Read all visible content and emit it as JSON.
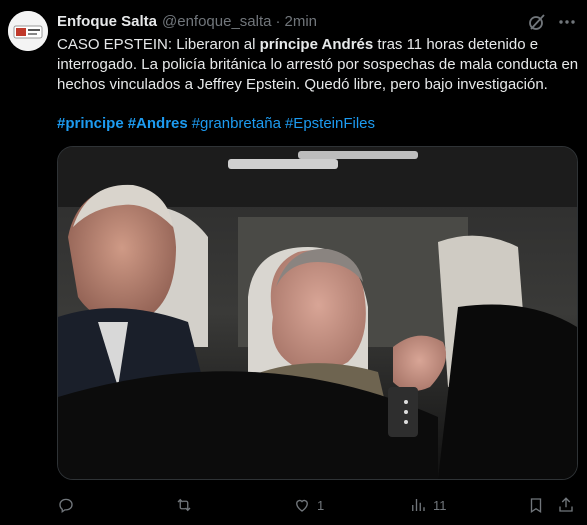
{
  "tweet": {
    "author_name": "Enfoque Salta",
    "handle": "@enfoque_salta",
    "separator": "·",
    "time": "2min",
    "text_1": "CASO EPSTEIN: Liberaron al ",
    "text_bold": "príncipe Andrés",
    "text_2": " tras 11 horas detenido e interrogado. La policía británica lo arrestó por sospechas de mala conducta en hechos vinculados a Jeffrey Epstein. Quedó libre, pero bajo investigación.",
    "hashtags": [
      {
        "text": "#principe",
        "bold": true
      },
      {
        "text": "#Andres",
        "bold": true
      },
      {
        "text": "#granbretaña",
        "bold": false
      },
      {
        "text": "#EpsteinFiles",
        "bold": false
      }
    ]
  },
  "actions": {
    "reply_count": "",
    "retweet_count": "",
    "like_count": "1",
    "views_count": "11",
    "bookmark_count": "",
    "share_count": ""
  },
  "icons": {
    "reply": "reply-icon",
    "retweet": "retweet-icon",
    "like": "heart-icon",
    "views": "views-icon",
    "bookmark": "bookmark-icon",
    "share": "share-icon",
    "grok": "grok-icon",
    "more": "more-icon"
  },
  "colors": {
    "background": "#000000",
    "text": "#e7e9ea",
    "muted": "#71767b",
    "link": "#1d9bf0"
  }
}
